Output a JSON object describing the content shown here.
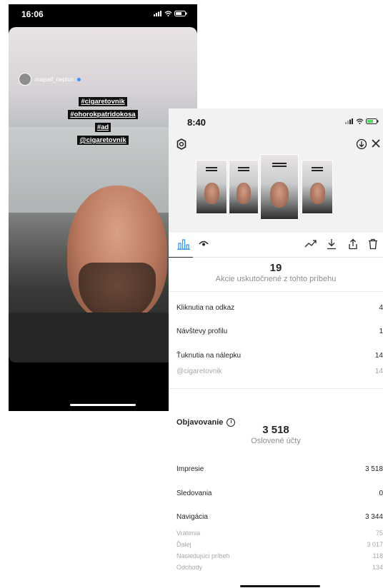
{
  "story": {
    "status_time": "16:06",
    "username": "majself_neptun",
    "tags": [
      "#cigaretovnik",
      "#ohorokpatridokosa",
      "#ad",
      "@cigaretovnik"
    ]
  },
  "insights": {
    "status_time": "8:40",
    "actions": {
      "total": "19",
      "label": "Akcie uskutočnené z tohto príbehu",
      "rows": [
        {
          "label": "Kliknutia na odkaz",
          "value": "4"
        },
        {
          "label": "Návštevy profilu",
          "value": "1"
        },
        {
          "label": "Ťuknutia na nálepku",
          "value": "14"
        }
      ],
      "sub_row": {
        "label": "@cigaretovnik",
        "value": "14"
      }
    },
    "discovery": {
      "title": "Objavovanie",
      "total": "3 518",
      "label": "Oslovené účty",
      "rows": [
        {
          "label": "Impresie",
          "value": "3 518"
        },
        {
          "label": "Sledovania",
          "value": "0"
        },
        {
          "label": "Navigácia",
          "value": "3 344"
        }
      ],
      "nav_rows": [
        {
          "label": "Vrátenia",
          "value": "75"
        },
        {
          "label": "Ďalej",
          "value": "3 017"
        },
        {
          "label": "Nasledujúci príbeh",
          "value": "118"
        },
        {
          "label": "Odchody",
          "value": "134"
        }
      ]
    },
    "icons": [
      "gear-icon",
      "download-icon",
      "close-icon",
      "bar-chart-icon",
      "eye-icon",
      "trending-icon",
      "save-icon",
      "share-icon",
      "delete-icon",
      "info-icon"
    ]
  }
}
